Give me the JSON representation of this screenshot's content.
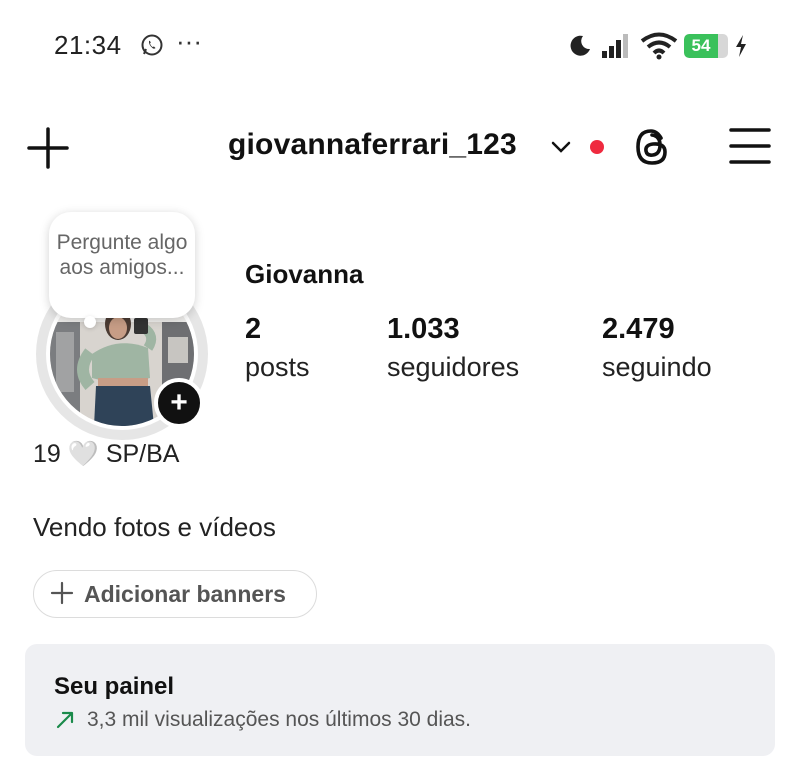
{
  "status_bar": {
    "time": "21:34",
    "dots": "···",
    "battery_level": "54",
    "icons": [
      "whatsapp-icon",
      "moon-icon",
      "signal-icon",
      "wifi-icon",
      "battery-icon",
      "charging-bolt-icon"
    ]
  },
  "header": {
    "username": "giovannaferrari_123",
    "icons": [
      "plus-icon",
      "chevron-down-icon",
      "notification-dot",
      "threads-icon",
      "menu-icon"
    ],
    "accent_red": "#ef2a3f"
  },
  "note": {
    "placeholder": "Pergunte algo aos amigos..."
  },
  "profile": {
    "display_name": "Giovanna",
    "posts_count": "2",
    "posts_label": "posts",
    "followers_count": "1.033",
    "followers_label": "seguidores",
    "following_count": "2.479",
    "following_label": "seguindo",
    "info_line": "19 🤍 SP/BA",
    "bio": "Vendo fotos e vídeos"
  },
  "banners": {
    "label": "Adicionar banners"
  },
  "dashboard": {
    "title": "Seu painel",
    "subtitle": "3,3 mil visualizações nos últimos 30 dias.",
    "accent_green": "#1a8a4a"
  }
}
